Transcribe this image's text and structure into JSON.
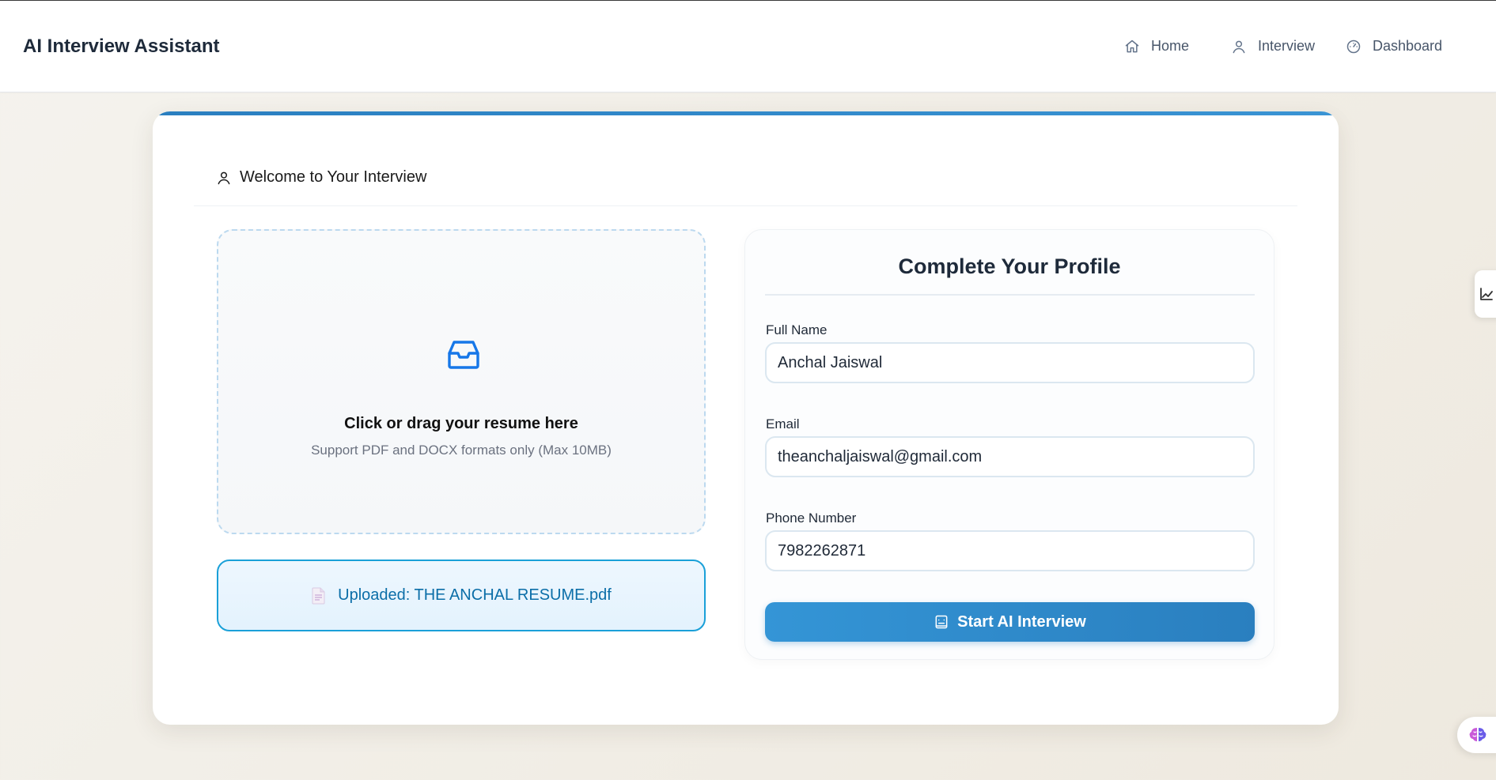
{
  "header": {
    "brand": "AI Interview Assistant",
    "nav": [
      {
        "label": "Home",
        "icon": "home-icon"
      },
      {
        "label": "Interview",
        "icon": "user-icon"
      },
      {
        "label": "Dashboard",
        "icon": "dashboard-icon"
      }
    ]
  },
  "card": {
    "heading": "Welcome to Your Interview",
    "heading_icon": "user-icon",
    "accent_color": "#2a7fc0"
  },
  "dropzone": {
    "icon": "inbox-icon",
    "title": "Click or drag your resume here",
    "subtitle": "Support PDF and DOCX formats only (Max 10MB)"
  },
  "uploaded": {
    "icon": "file-icon",
    "text": "Uploaded: THE ANCHAL RESUME.pdf"
  },
  "profile": {
    "title": "Complete Your Profile",
    "fields": [
      {
        "label": "Full Name",
        "value": "Anchal Jaiswal"
      },
      {
        "label": "Email",
        "value": "theanchaljaiswal@gmail.com"
      },
      {
        "label": "Phone Number",
        "value": "7982262871"
      }
    ],
    "submit": {
      "label": "Start AI Interview",
      "icon": "robot-icon"
    }
  },
  "floating": {
    "side_tab_icon": "chart-icon",
    "assistant_icon": "brain-icon"
  }
}
